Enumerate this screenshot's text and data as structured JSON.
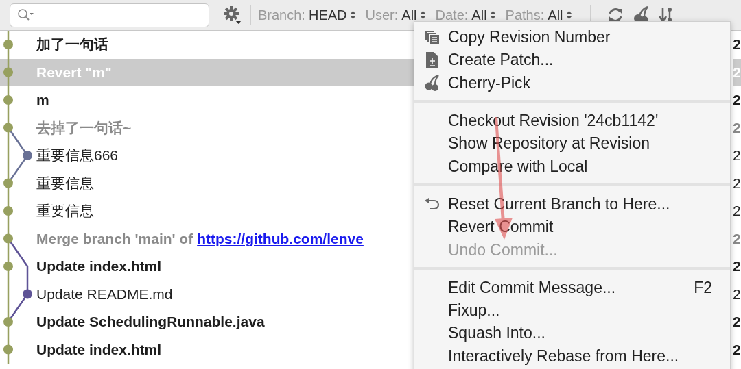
{
  "filters": [
    {
      "label": "Branch:",
      "value": "HEAD"
    },
    {
      "label": "User:",
      "value": "All"
    },
    {
      "label": "Date:",
      "value": "All"
    },
    {
      "label": "Paths:",
      "value": "All"
    }
  ],
  "rows": [
    {
      "message": "加了一句话",
      "in_head": true,
      "merge": false,
      "kind": "main",
      "color": "#97a05f",
      "selected": false,
      "date": "2"
    },
    {
      "message": "Revert \"m\"",
      "in_head": true,
      "merge": false,
      "kind": "main",
      "color": "#97a05f",
      "selected": true,
      "date": "2"
    },
    {
      "message": "m",
      "in_head": true,
      "merge": false,
      "kind": "main",
      "color": "#97a05f",
      "selected": false,
      "date": "2"
    },
    {
      "message": "去掉了一句话~",
      "in_head": false,
      "merge": true,
      "kind": "main",
      "color": "#97a05f",
      "selected": false,
      "date": "2"
    },
    {
      "message": "重要信息666",
      "in_head": false,
      "merge": false,
      "kind": "side",
      "color": "#687095",
      "selected": false,
      "date": "2"
    },
    {
      "message": "重要信息",
      "in_head": false,
      "merge": false,
      "kind": "main",
      "color": "#97a05f",
      "selected": false,
      "date": "2"
    },
    {
      "message": "重要信息",
      "in_head": false,
      "merge": false,
      "kind": "main",
      "color": "#97a05f",
      "selected": false,
      "date": "2"
    },
    {
      "message": "Merge branch 'main' of",
      "link": "https://github.com/lenve",
      "in_head": false,
      "merge": true,
      "kind": "main",
      "color": "#97a05f",
      "selected": false,
      "date": "2"
    },
    {
      "message": "Update index.html",
      "in_head": true,
      "merge": false,
      "kind": "main",
      "color": "#97a05f",
      "selected": false,
      "date": "2"
    },
    {
      "message": "Update README.md",
      "in_head": false,
      "merge": false,
      "kind": "side",
      "color": "#5e5396",
      "selected": false,
      "date": "2"
    },
    {
      "message": "Update SchedulingRunnable.java",
      "in_head": true,
      "merge": false,
      "kind": "main",
      "color": "#97a05f",
      "selected": false,
      "date": "2"
    },
    {
      "message": "Update index.html",
      "in_head": true,
      "merge": false,
      "kind": "main",
      "color": "#97a05f",
      "selected": false,
      "date": "2"
    }
  ],
  "context_menu": {
    "groups": [
      [
        {
          "label": "Copy Revision Number",
          "kind": "copy",
          "disabled": false
        },
        {
          "label": "Create Patch...",
          "kind": "patch",
          "disabled": false
        },
        {
          "label": "Cherry-Pick",
          "kind": "cherry",
          "disabled": false
        }
      ],
      [
        {
          "label": "Checkout Revision '24cb1142'",
          "kind": "plain",
          "disabled": false
        },
        {
          "label": "Show Repository at Revision",
          "kind": "plain",
          "disabled": false
        },
        {
          "label": "Compare with Local",
          "kind": "plain",
          "disabled": false
        }
      ],
      [
        {
          "label": "Reset Current Branch to Here...",
          "kind": "reset",
          "disabled": false
        },
        {
          "label": "Revert Commit",
          "kind": "plain",
          "disabled": false
        },
        {
          "label": "Undo Commit...",
          "kind": "plain",
          "disabled": true
        }
      ],
      [
        {
          "label": "Edit Commit Message...",
          "shortcut": "F2",
          "kind": "plain",
          "disabled": false
        },
        {
          "label": "Fixup...",
          "kind": "plain",
          "disabled": false
        },
        {
          "label": "Squash Into...",
          "kind": "plain",
          "disabled": false
        },
        {
          "label": "Interactively Rebase from Here...",
          "kind": "plain",
          "disabled": false
        }
      ]
    ]
  }
}
